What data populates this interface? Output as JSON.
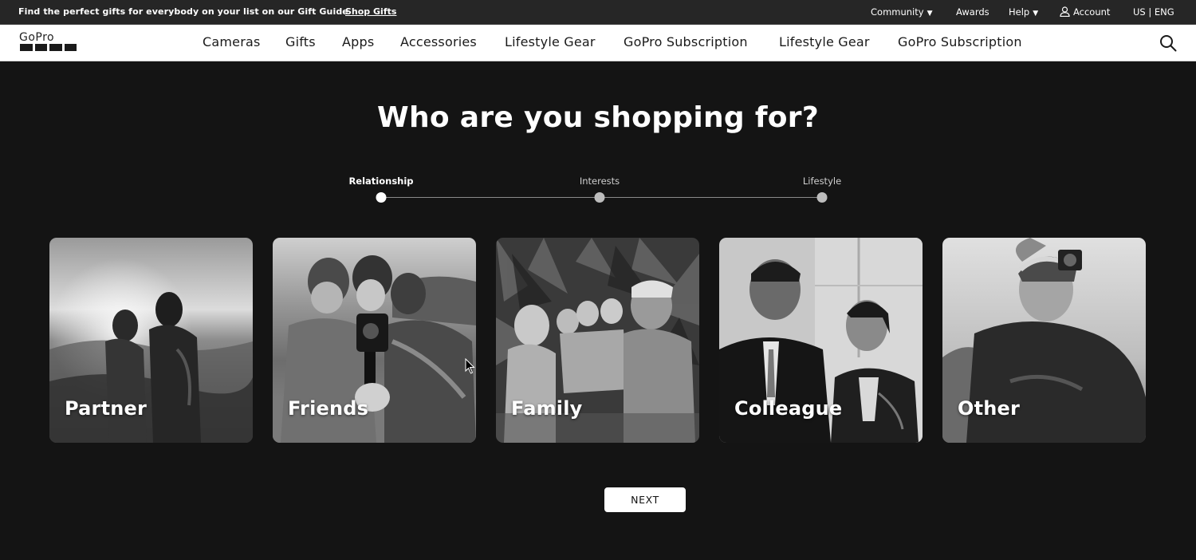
{
  "promo": {
    "text": "Find the perfect gifts for everybody on your list on our Gift Guide",
    "link": "Shop Gifts"
  },
  "utility_nav": {
    "community": "Community",
    "awards": "Awards",
    "help": "Help",
    "account": "Account",
    "locale": "US | ENG"
  },
  "logo": {
    "text": "GoPro"
  },
  "nav": {
    "items": [
      "Cameras",
      "Gifts",
      "Apps",
      "Accessories",
      "Lifestyle Gear",
      "GoPro Subscription",
      "Lifestyle Gear",
      "GoPro Subscription"
    ]
  },
  "main": {
    "title": "Who are you shopping for?",
    "steps": [
      {
        "label": "Relationship",
        "active": true
      },
      {
        "label": "Interests",
        "active": false
      },
      {
        "label": "Lifestyle",
        "active": false
      }
    ],
    "cards": [
      {
        "label": "Partner",
        "icon": "partner-photo"
      },
      {
        "label": "Friends",
        "icon": "friends-photo"
      },
      {
        "label": "Family",
        "icon": "family-photo"
      },
      {
        "label": "Colleague",
        "icon": "colleague-photo"
      },
      {
        "label": "Other",
        "icon": "other-photo"
      }
    ],
    "next_label": "NEXT"
  },
  "colors": {
    "background": "#141414",
    "promo_bar": "#262626",
    "nav_bar": "#ffffff",
    "text_dark": "#1a1a1a"
  }
}
